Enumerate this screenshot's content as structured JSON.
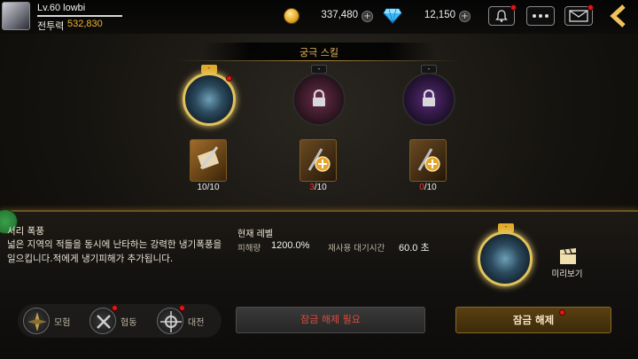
{
  "profile": {
    "level": "Lv.60 lowbi",
    "combat_power_label": "전투력",
    "combat_power": "532,830"
  },
  "currency": {
    "gold": "337,480",
    "diamond": "12,150",
    "plus": "+"
  },
  "header": {
    "title": "궁극 스킬",
    "icons": [
      "bell-icon",
      "chat-icon",
      "mail-icon",
      "back-arrow-icon"
    ]
  },
  "skills": [
    {
      "tag": "-",
      "count_current": "10",
      "count_max": "/10",
      "count_color": "#f0f0f0",
      "locked": false
    },
    {
      "tag": "-",
      "count_current": "3",
      "count_max": "/10",
      "count_color": "#e83a3a",
      "locked": true
    },
    {
      "tag": "-",
      "count_current": "0",
      "count_max": "/10",
      "count_color": "#e83a3a",
      "locked": true
    }
  ],
  "detail": {
    "name": "서리 폭풍",
    "description": "넓은 지역의 적들을 동시에 난타하는 강력한 냉기폭풍을 일으킵니다.적에게 냉기피해가 추가됩니다.",
    "level_heading": "현재 레벨",
    "damage_label": "피해량",
    "damage_value": "1200.0%",
    "cooldown_label": "재사용 대기시간",
    "cooldown_value": "60.0 초",
    "selected_tag": "-",
    "preview_label": "미리보기"
  },
  "nav": [
    {
      "label": "모험",
      "badge": false
    },
    {
      "label": "협동",
      "badge": true
    },
    {
      "label": "대전",
      "badge": true
    }
  ],
  "buttons": {
    "unlock_required": "잠금 해제 필요",
    "unlock": "잠금 해제"
  },
  "colors": {
    "accent_gold": "#e0a92a",
    "alert_red": "#e01818",
    "combat_power": "#f2b233"
  }
}
